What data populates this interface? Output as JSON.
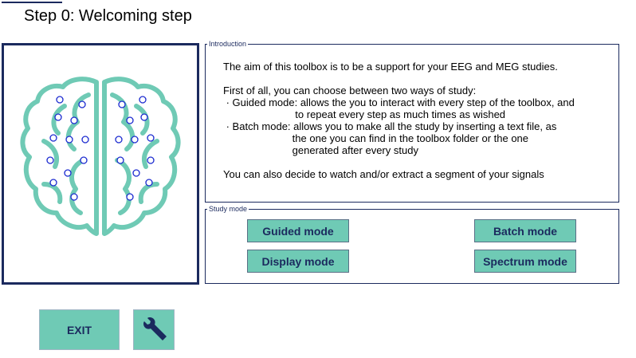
{
  "header": {
    "title": "Step 0: Welcoming step"
  },
  "introduction": {
    "legend": "Introduction",
    "text": "The aim of this toolbox is to be a support for your EEG and MEG studies.\n\nFirst of all, you can choose between two ways of study:\n · Guided mode: allows the you to interact with every step of the toolbox, and\n                         to repeat every step as much times as wished\n · Batch mode: allows you to make all the study by inserting a text file, as\n                        the one you can find in the toolbox folder or the one\n                        generated after every study\n\nYou can also decide to watch and/or extract a segment of your signals"
  },
  "study_mode": {
    "legend": "Study mode",
    "guided_label": "Guided mode",
    "batch_label": "Batch mode",
    "display_label": "Display mode",
    "spectrum_label": "Spectrum mode"
  },
  "footer": {
    "exit_label": "EXIT",
    "settings_icon": "wrench-icon"
  },
  "colors": {
    "accent": "#6fcab5",
    "navy": "#1b2a5e",
    "brain": "#6fcab5",
    "electrode": "#1b2ad0"
  },
  "image": {
    "icon": "brain-eeg-icon"
  }
}
